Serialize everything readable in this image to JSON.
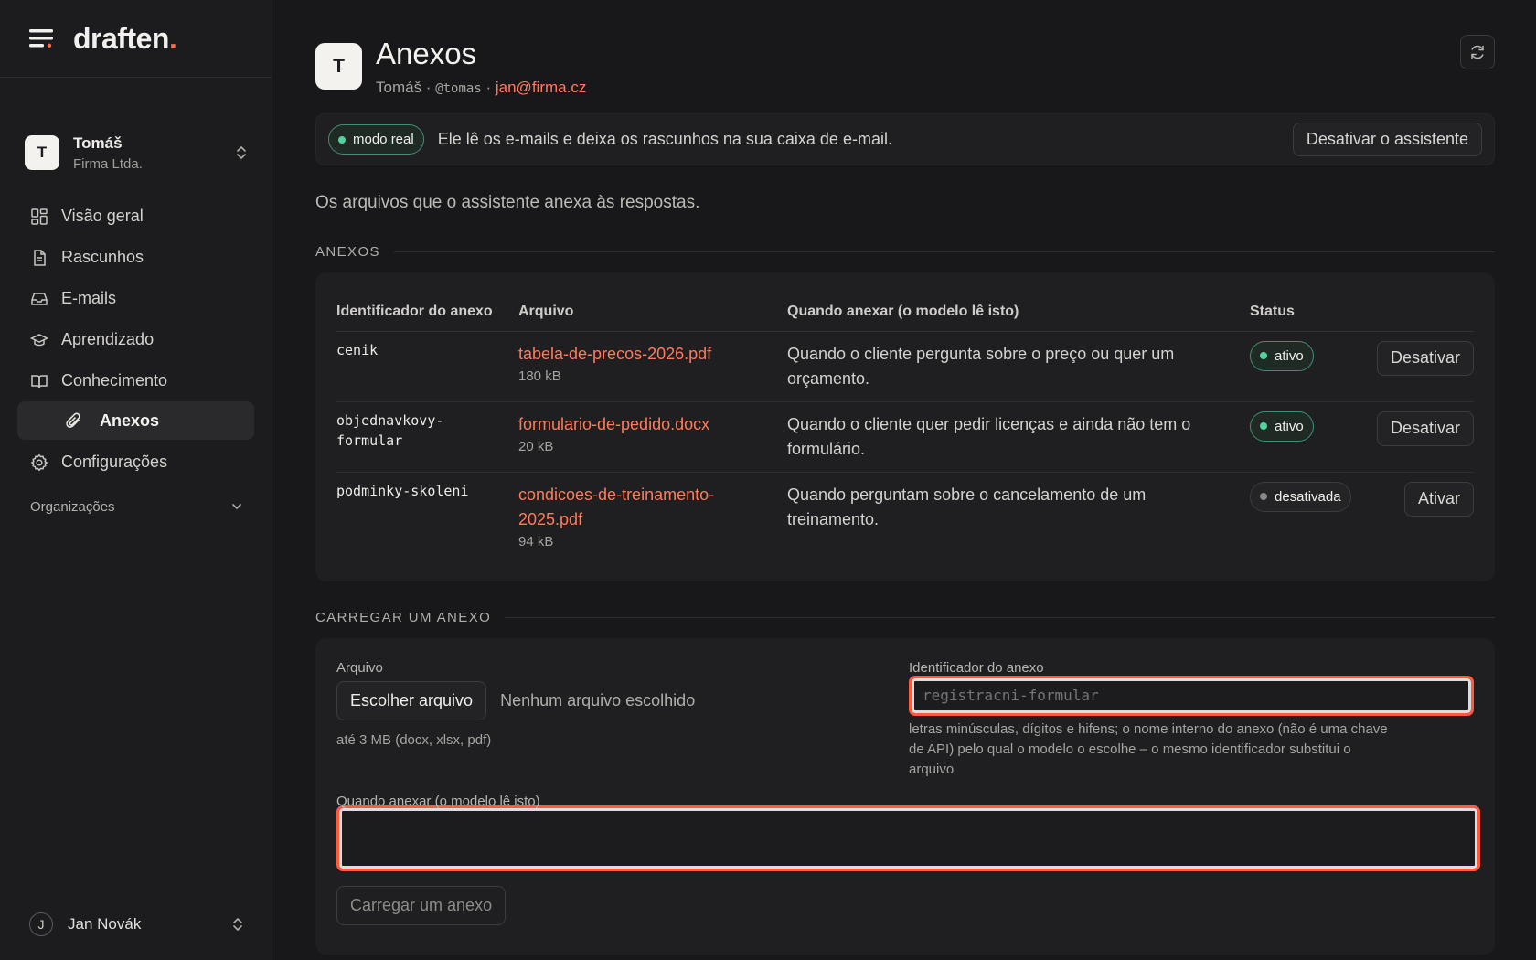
{
  "app": {
    "logo_text": "draften",
    "logo_dot": "."
  },
  "sidebar": {
    "org": {
      "avatar": "T",
      "name": "Tomáš",
      "company": "Firma Ltda."
    },
    "items": [
      {
        "label": "Visão geral",
        "icon": "grid-icon"
      },
      {
        "label": "Rascunhos",
        "icon": "document-icon"
      },
      {
        "label": "E-mails",
        "icon": "inbox-icon"
      },
      {
        "label": "Aprendizado",
        "icon": "graduation-cap-icon"
      },
      {
        "label": "Conhecimento",
        "icon": "book-icon"
      }
    ],
    "sub_item": {
      "label": "Anexos",
      "icon": "paperclip-icon"
    },
    "settings": {
      "label": "Configurações",
      "icon": "gear-icon"
    },
    "section": {
      "label": "Organizações"
    },
    "user": {
      "avatar": "J",
      "name": "Jan Novák"
    }
  },
  "header": {
    "avatar": "T",
    "title": "Anexos",
    "user_name": "Tomáš",
    "separator": " · ",
    "handle": "@tomas",
    "email": "jan@firma.cz"
  },
  "banner": {
    "mode_label": "modo real",
    "text": "Ele lê os e-mails e deixa os rascunhos na sua caixa de e-mail.",
    "button": "Desativar o assistente"
  },
  "description": "Os arquivos que o assistente anexa às respostas.",
  "attachments": {
    "section_title": "ANEXOS",
    "columns": [
      "Identificador do anexo",
      "Arquivo",
      "Quando anexar (o modelo lê isto)",
      "Status"
    ],
    "rows": [
      {
        "id_line1": "cenik",
        "id_line2": "",
        "file": "tabela-de-precos-2026.pdf",
        "file_line2": "",
        "size": "180 kB",
        "when": "Quando o cliente pergunta sobre o preço ou quer um orçamento.",
        "status": "ativo",
        "active": true,
        "action": "Desativar"
      },
      {
        "id_line1": "objednavkovy-",
        "id_line2": "formular",
        "file": "formulario-de-pedido.docx",
        "file_line2": "",
        "size": "20 kB",
        "when": "Quando o cliente quer pedir licenças e ainda não tem o formulário.",
        "status": "ativo",
        "active": true,
        "action": "Desativar"
      },
      {
        "id_line1": "podminky-skoleni",
        "id_line2": "",
        "file": "condicoes-de-treinamento-",
        "file_line2": "2025.pdf",
        "size": "94 kB",
        "when": "Quando perguntam sobre o cancelamento de um treinamento.",
        "status": "desativada",
        "active": false,
        "action": "Ativar"
      }
    ]
  },
  "upload": {
    "section_title": "CARREGAR UM ANEXO",
    "file_label": "Arquivo",
    "choose_button": "Escolher arquivo",
    "no_file": "Nenhum arquivo escolhido",
    "file_hint": "até 3 MB (docx, xlsx, pdf)",
    "id_label": "Identificador do anexo",
    "id_placeholder": "registracni-formular",
    "id_hint": "letras minúsculas, dígitos e hifens; o nome interno do anexo (não é uma chave de API) pelo qual o modelo o escolhe – o mesmo identificador substitui o arquivo",
    "when_label": "Quando anexar (o modelo lê isto)",
    "when_value": "",
    "submit": "Carregar um anexo"
  },
  "colors": {
    "accent": "#ff7a5c",
    "active_green": "#4fd39f",
    "focus_ring": "#ff5a3c"
  }
}
